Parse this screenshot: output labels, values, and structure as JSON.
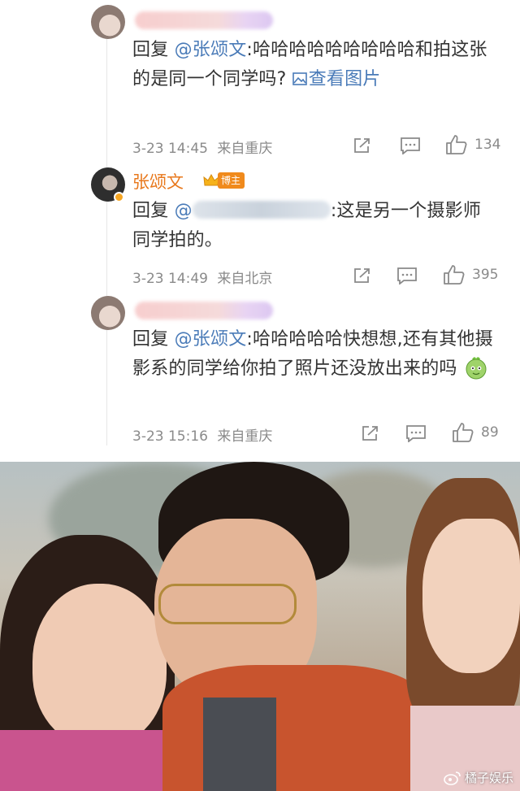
{
  "comments": [
    {
      "author_type": "fan",
      "reply_prefix": "回复",
      "mention": "@张颂文",
      "text_after_mention": ":哈哈哈哈哈哈哈哈哈和拍这张的是同一个同学吗?",
      "image_link": "查看图片",
      "time": "3-23 14:45",
      "source": "来自重庆",
      "likes": "134"
    },
    {
      "author_type": "blogger",
      "author_name": "张颂文",
      "badge": "博主",
      "reply_prefix": "回复",
      "mention": "@",
      "text_after_mention": ":这是另一个摄影师同学拍的。",
      "time": "3-23 14:49",
      "source": "来自北京",
      "likes": "395"
    },
    {
      "author_type": "fan",
      "reply_prefix": "回复",
      "mention": "@张颂文",
      "text_after_mention": ":哈哈哈哈哈快想想,还有其他摄影系的同学给你拍了照片还没放出来的吗",
      "time": "3-23 15:16",
      "source": "来自重庆",
      "likes": "89"
    }
  ],
  "photo": {
    "watermark": "橘子娱乐",
    "watermark_icon": "weibo-icon"
  },
  "icons": {
    "share": "share-icon",
    "comment": "comment-icon",
    "like": "like-icon",
    "image": "image-icon",
    "crown": "crown-icon",
    "emoji": "emoji-icon"
  },
  "colors": {
    "link": "#4a7bb8",
    "blogger_name": "#e8781c",
    "badge_bg": "#f08a1c",
    "meta_text": "#8a8a8a"
  }
}
